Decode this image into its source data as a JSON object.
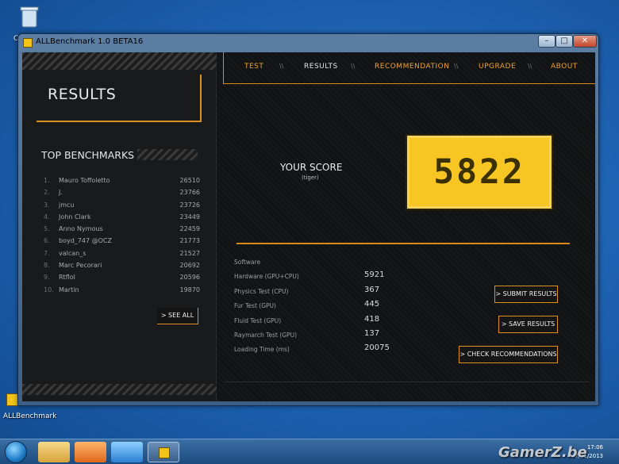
{
  "window": {
    "title": "ALLBenchmark 1.0 BETA16",
    "min_label": "–",
    "max_label": "□",
    "close_label": "✕"
  },
  "desktop": {
    "recycle_bin_letter": "C",
    "app_shortcut": "ALLBenchmark"
  },
  "nav": {
    "tabs": [
      "TEST",
      "RESULTS",
      "RECOMMENDATION",
      "UPGRADE",
      "ABOUT"
    ],
    "separator": "\\\\"
  },
  "results": {
    "title": "RESULTS",
    "top_title": "TOP BENCHMARKS",
    "see_all": "> SEE ALL",
    "benchmarks": [
      {
        "rank": "1.",
        "name": "Mauro Toffoletto",
        "score": "26510"
      },
      {
        "rank": "2.",
        "name": "J.",
        "score": "23766"
      },
      {
        "rank": "3.",
        "name": "jmcu",
        "score": "23726"
      },
      {
        "rank": "4.",
        "name": "John Clark",
        "score": "23449"
      },
      {
        "rank": "5.",
        "name": "Anno Nymous",
        "score": "22459"
      },
      {
        "rank": "6.",
        "name": "boyd_747 @OCZ",
        "score": "21773"
      },
      {
        "rank": "7.",
        "name": "valcan_s",
        "score": "21527"
      },
      {
        "rank": "8.",
        "name": "Marc Pecorari",
        "score": "20692"
      },
      {
        "rank": "9.",
        "name": "Rtflol",
        "score": "20596"
      },
      {
        "rank": "10.",
        "name": "Martin",
        "score": "19870"
      }
    ]
  },
  "score": {
    "label": "YOUR SCORE",
    "tag": "(tiger)",
    "value": "5822"
  },
  "stats": [
    {
      "label": "Software",
      "value": ""
    },
    {
      "label": "Hardware (GPU+CPU)",
      "value": "5921"
    },
    {
      "label": "Physics Test (CPU)",
      "value": "367"
    },
    {
      "label": "Fur Test (GPU)",
      "value": "445"
    },
    {
      "label": "Fluid Test (GPU)",
      "value": "418"
    },
    {
      "label": "Raymarch Test (GPU)",
      "value": "137"
    },
    {
      "label": "Loading Time (ms)",
      "value": "20075"
    }
  ],
  "actions": {
    "submit": "> SUBMIT RESULTS",
    "save": "> SAVE RESULTS",
    "check": "> CHECK RECOMMENDATIONS"
  },
  "taskbar": {
    "time": "17:06",
    "date": "7/01/2013"
  },
  "watermark": "GamerZ.be",
  "colors": {
    "accent": "#f2a32b",
    "score_bg": "#f7c623",
    "app_bg": "#101214"
  }
}
